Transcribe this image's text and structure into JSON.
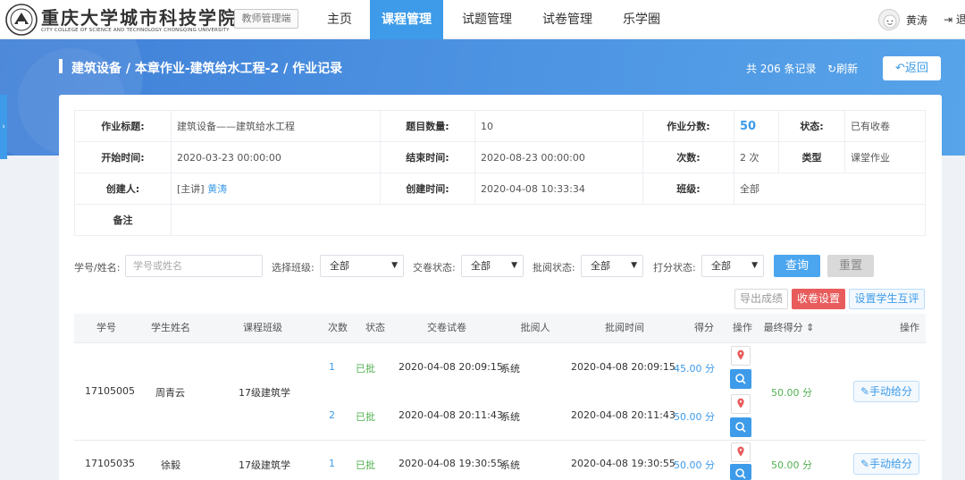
{
  "header": {
    "school_name": "重庆大学城市科技学院",
    "school_en": "CITY COLLEGE OF SCIENCE AND TECHNOLOGY CHONGQING UNIVERSITY",
    "portal": "教师管理端",
    "nav": [
      {
        "label": "主页",
        "active": false
      },
      {
        "label": "课程管理",
        "active": true
      },
      {
        "label": "试题管理",
        "active": false
      },
      {
        "label": "试卷管理",
        "active": false
      },
      {
        "label": "乐学圈",
        "active": false
      }
    ],
    "user": "黄涛",
    "logout": "退"
  },
  "banner": {
    "breadcrumb": "建筑设备 / 本章作业-建筑给水工程-2 / 作业记录",
    "record_count": "共 206 条记录",
    "refresh": "刷新",
    "back": "返回"
  },
  "info": {
    "title_label": "作业标题:",
    "title_value": "建筑设备——建筑给水工程",
    "count_label": "题目数量:",
    "count_value": "10",
    "score_label": "作业分数:",
    "score_value": "50",
    "status_label": "状态:",
    "status_value": "已有收卷",
    "start_label": "开始时间:",
    "start_value": "2020-03-23 00:00:00",
    "end_label": "结束时间:",
    "end_value": "2020-08-23 00:00:00",
    "times_label": "次数:",
    "times_value": "2 次",
    "type_label": "类型",
    "type_value": "课堂作业",
    "creator_label": "创建人:",
    "creator_role": "[主讲]",
    "creator_name": "黄涛",
    "created_label": "创建时间:",
    "created_value": "2020-04-08 10:33:34",
    "class_label": "班级:",
    "class_value": "全部",
    "note_label": "备注",
    "note_value": ""
  },
  "filters": {
    "student_label": "学号/姓名:",
    "student_placeholder": "学号或姓名",
    "class_label": "选择班级:",
    "class_value": "全部",
    "submit_label": "交卷状态:",
    "submit_value": "全部",
    "review_label": "批阅状态:",
    "review_value": "全部",
    "grade_label": "打分状态:",
    "grade_value": "全部",
    "query": "查询",
    "reset": "重置"
  },
  "actions": {
    "export": "导出成绩",
    "collect": "收卷设置",
    "peer": "设置学生互评"
  },
  "table": {
    "columns": [
      "学号",
      "学生姓名",
      "课程班级",
      "次数",
      "状态",
      "交卷试卷",
      "批阅人",
      "批阅时间",
      "得分",
      "操作",
      "最终得分",
      "操作"
    ],
    "rows": [
      {
        "id": "17105005",
        "name": "周青云",
        "class": "17级建筑学",
        "attempts": [
          {
            "n": "1",
            "status": "已批",
            "submit_time": "2020-04-08 20:09:15",
            "reviewer": "系统",
            "review_time": "2020-04-08 20:09:15",
            "score": "45.00 分"
          },
          {
            "n": "2",
            "status": "已批",
            "submit_time": "2020-04-08 20:11:43",
            "reviewer": "系统",
            "review_time": "2020-04-08 20:11:43",
            "score": "50.00 分"
          }
        ],
        "final": "50.00 分",
        "manual": "手动给分"
      },
      {
        "id": "17105035",
        "name": "徐毅",
        "class": "17级建筑学",
        "attempts": [
          {
            "n": "1",
            "status": "已批",
            "submit_time": "2020-04-08 19:30:55",
            "reviewer": "系统",
            "review_time": "2020-04-08 19:30:55",
            "score": "50.00 分"
          }
        ],
        "final": "50.00 分",
        "manual": "手动给分"
      }
    ]
  }
}
